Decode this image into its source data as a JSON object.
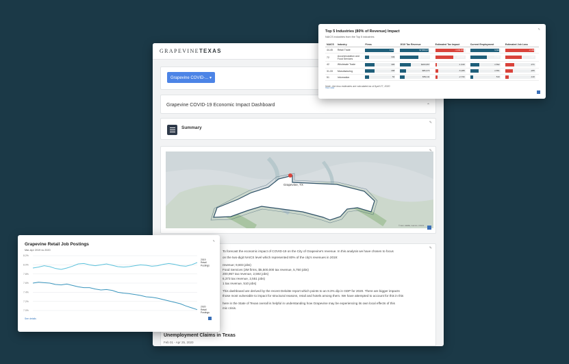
{
  "main": {
    "logo_a": "GRAPEVINE",
    "logo_b": "TEXAS",
    "select_label": "Grapevine COVID-... ▾",
    "dashboard_title": "Grapevine COVID-19 Economic Impact Dashboard",
    "summary_title": "Summary",
    "map_city_label": "Grapevine, TX",
    "map_attribution": "© Esri, HERE, Garmin, USGS",
    "text_lines": [
      "To forecast the economic impact of COVID-19 on the City of Grapevine's revenue. In this analysis we have chosen to focus",
      "on the two-digit NAICS level which represented 80% of the city's revenues in 2019:",
      "revenue; 9,603 jobs)",
      "Food Services (3M firms, $5,500,000 tax revenue, 5,750 jobs)",
      "200,957 tax revenue, 2,592 jobs)",
      "6,373 tax revenue, 2,551 jobs)",
      "1 tax revenue, 510 jobs)",
      "This dashboard are derived by the recent Deloitte report which points to an 8.3% dip in GDP for 2020. There are bigger impacts",
      "those most vulnerable to impact for structural reasons, retail and hotels among them. We have attempted to account for this in this",
      "here in the State of Texas overall is helpful in understanding how Grapevine may be experiencing its own local effects of this",
      "mic crisis."
    ],
    "section_title": "Unemployment Claims in Texas",
    "section_sub": "Feb 01 - Apr 25, 2020"
  },
  "top": {
    "title": "Top 5 Industries (80% of Revenue) Impact",
    "subtitle": "NAICS industries from the Top 5 industries",
    "columns": [
      "NAICS",
      "Industry",
      "Firms",
      "2019 Tax Revenue",
      "Estimated Tax Impact",
      "Current Employment",
      "Estimated Job Loss"
    ],
    "rows": [
      {
        "naics": "44-45",
        "industry": "Retail Trade",
        "firms": "1,017",
        "firms_pct": 0.95,
        "rev": "$7,869,277",
        "rev_pct": 0.95,
        "impact": "-1,191,806",
        "impact_pct": 0.95,
        "emp": "9,603",
        "emp_pct": 0.95,
        "loss": "-2,336",
        "loss_pct": 0.95
      },
      {
        "naics": "72",
        "industry": "Accommodation and Food Services",
        "firms": "349",
        "firms_pct": 0.12,
        "rev": "$5,500,000",
        "rev_pct": 0.6,
        "impact": "-945,893",
        "impact_pct": 0.6,
        "emp": "5,750",
        "emp_pct": 0.55,
        "loss": "-1,605",
        "loss_pct": 0.55
      },
      {
        "naics": "42",
        "industry": "Wholesale Trade",
        "firms": "395",
        "firms_pct": 0.32,
        "rev": "$200,957",
        "rev_pct": 0.35,
        "impact": "-1,649",
        "impact_pct": 0.05,
        "emp": "2,592",
        "emp_pct": 0.3,
        "loss": "-371",
        "loss_pct": 0.3
      },
      {
        "naics": "31-33",
        "industry": "Manufacturing",
        "firms": "298",
        "firms_pct": 0.3,
        "rev": "$86,373",
        "rev_pct": 0.2,
        "impact": "-5,288",
        "impact_pct": 0.1,
        "emp": "2,551",
        "emp_pct": 0.28,
        "loss": "-265",
        "loss_pct": 0.25
      },
      {
        "naics": "51",
        "industry": "Information",
        "firms": "52",
        "firms_pct": 0.12,
        "rev": "$59,111",
        "rev_pct": 0.15,
        "impact": "-2,734",
        "impact_pct": 0.07,
        "emp": "510",
        "emp_pct": 0.1,
        "loss": "-110",
        "loss_pct": 0.12
      }
    ],
    "link": "View data",
    "note": "Note: Job loss estimates are calculated as of April 27, 2020"
  },
  "jobs": {
    "title": "Grapevine Retail Job Postings",
    "subtitle": "Mar-Apr 2019 vs 2020",
    "link": "See details"
  },
  "chart_data": {
    "type": "line",
    "title": "Grapevine Retail Job Postings",
    "subtitle": "Mar-Apr 2019 vs 2020",
    "yticks": [
      "8.2%",
      "8.0%",
      "7.8%",
      "7.6%",
      "7.4%",
      "7.2%",
      "7.0%"
    ],
    "ylim": [
      7.0,
      8.2
    ],
    "series": [
      {
        "name": "2019 Retail Postings",
        "color": "#5bc2dc",
        "values": [
          7.93,
          7.95,
          7.98,
          7.96,
          7.92,
          7.9,
          7.93,
          7.97,
          8.02,
          8.03,
          8.0,
          7.98,
          8.0,
          8.02,
          7.99,
          7.96,
          7.95,
          7.96,
          7.98,
          8.0,
          7.99,
          7.97,
          7.98,
          8.01,
          8.03,
          8.01,
          7.98,
          7.97,
          8.0,
          8.05
        ]
      },
      {
        "name": "2020 Retail Postings",
        "color": "#3a95bd",
        "values": [
          7.6,
          7.62,
          7.61,
          7.6,
          7.57,
          7.56,
          7.58,
          7.55,
          7.52,
          7.5,
          7.5,
          7.47,
          7.45,
          7.46,
          7.44,
          7.4,
          7.38,
          7.37,
          7.35,
          7.33,
          7.3,
          7.29,
          7.27,
          7.24,
          7.21,
          7.18,
          7.15,
          7.1,
          7.06,
          7.02
        ]
      }
    ]
  },
  "colors": {
    "accent": "#4c84e6",
    "teal": "#1f5f7a",
    "red": "#d9433b",
    "bg": "#1b3947"
  }
}
